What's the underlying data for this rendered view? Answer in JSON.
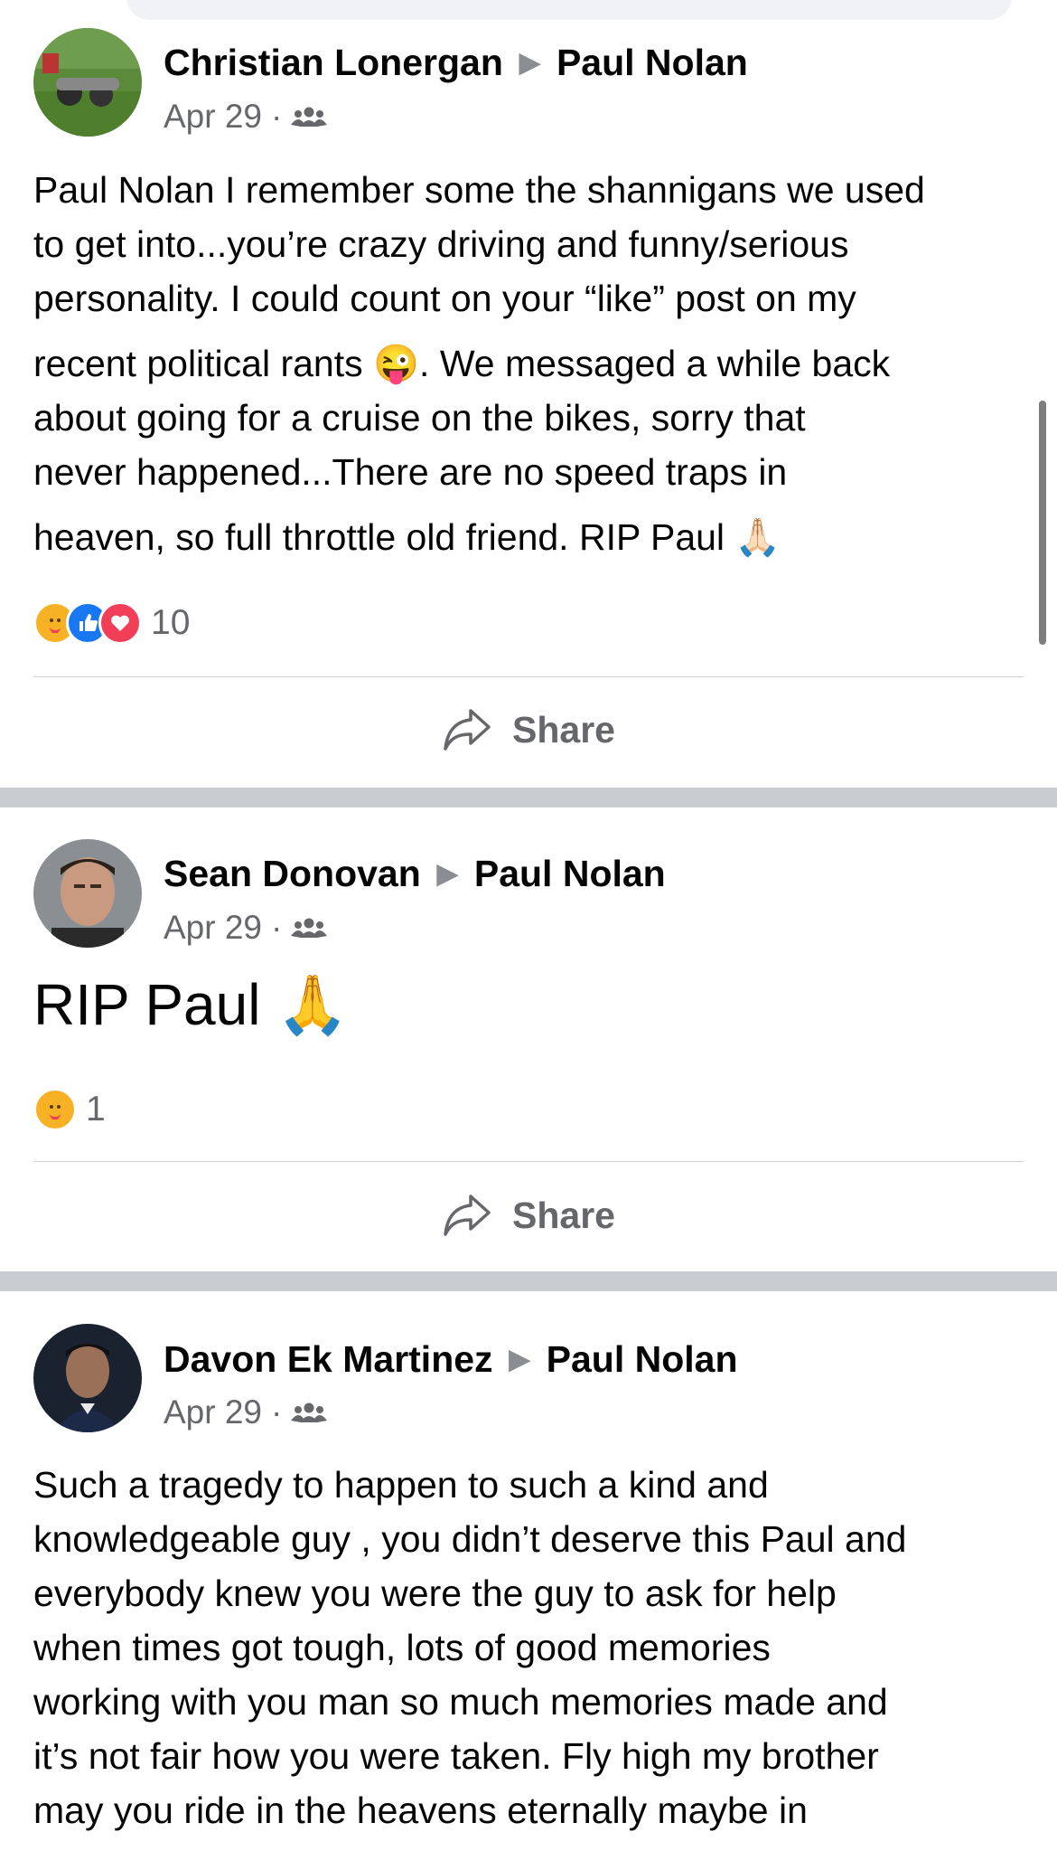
{
  "posts": [
    {
      "author": "Christian Lonergan",
      "target": "Paul Nolan",
      "date": "Apr 29",
      "audience_icon": "friends-icon",
      "lines": [
        "Paul Nolan I remember some the shannigans we used",
        "to get into...you’re crazy driving and funny/serious",
        "personality. I could count on your “like” post on my",
        "recent political rants 😜. We messaged a while back",
        "about going for a cruise on the bikes, sorry that",
        "never happened...There are no speed traps in",
        "heaven, so full throttle old friend. RIP Paul 🙏🏻"
      ],
      "reaction_count": "10",
      "reactions": [
        "care",
        "like",
        "love"
      ],
      "share_label": "Share"
    },
    {
      "author": "Sean Donovan",
      "target": "Paul Nolan",
      "date": "Apr 29",
      "audience_icon": "friends-icon",
      "text": "RIP Paul 🙏",
      "reaction_count": "1",
      "reactions": [
        "care"
      ],
      "share_label": "Share"
    },
    {
      "author": "Davon Ek Martinez",
      "target": "Paul Nolan",
      "date": "Apr 29",
      "audience_icon": "friends-icon",
      "lines": [
        "Such a tragedy to happen to such a kind and",
        "knowledgeable guy , you didn’t deserve this Paul and",
        "everybody knew you were the guy to ask for help",
        "when times got tough, lots of good memories",
        "working with you man so much memories made and",
        "it’s not fair how you were taken. Fly high my brother",
        "may you ride in the heavens eternally maybe in"
      ]
    }
  ],
  "colors": {
    "like": "#1877f2",
    "love": "#f33e58",
    "care": "#f7b125",
    "secondary_text": "#65676b",
    "separator": "#c9ccd1"
  }
}
